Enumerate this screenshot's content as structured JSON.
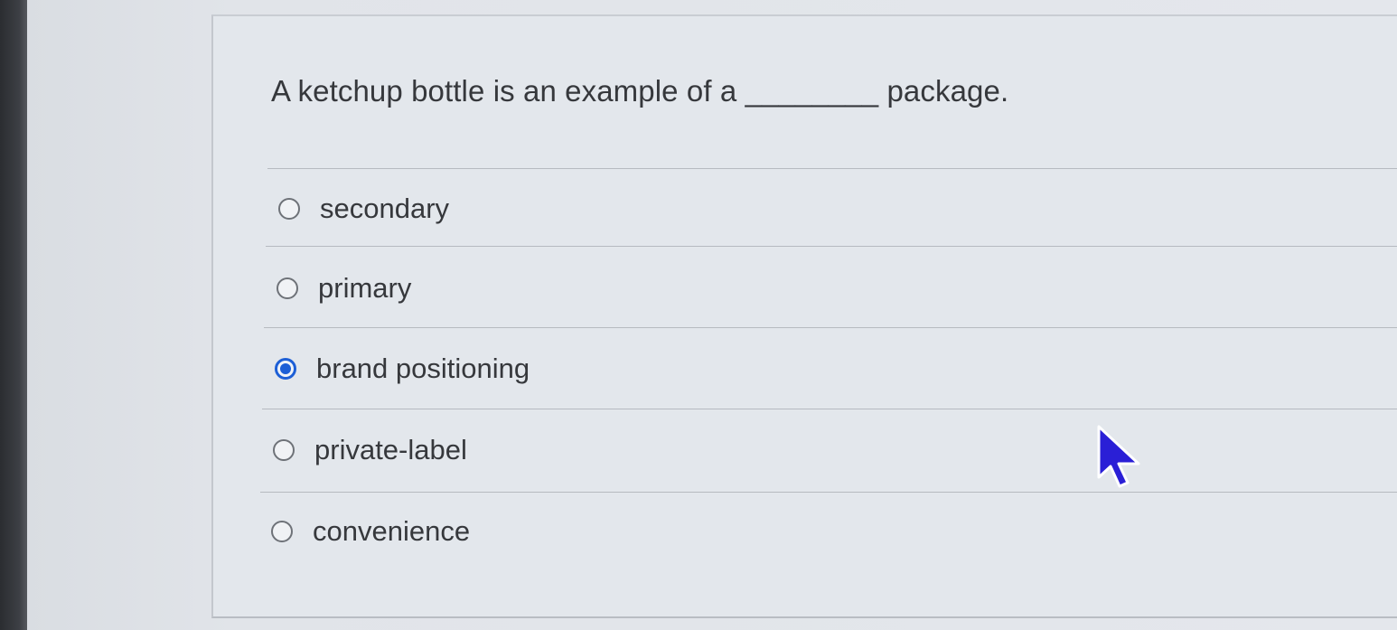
{
  "question": {
    "text": "A ketchup bottle is an example of a ________ package."
  },
  "options": [
    {
      "label": "secondary",
      "selected": false
    },
    {
      "label": "primary",
      "selected": false
    },
    {
      "label": "brand positioning",
      "selected": true
    },
    {
      "label": "private-label",
      "selected": false
    },
    {
      "label": "convenience",
      "selected": false
    }
  ],
  "colors": {
    "accent": "#1d5fd6",
    "cursor": "#2a1fd6"
  },
  "icons": {
    "pointer": "mouse-pointer-icon",
    "radio": "radio-button-icon"
  }
}
